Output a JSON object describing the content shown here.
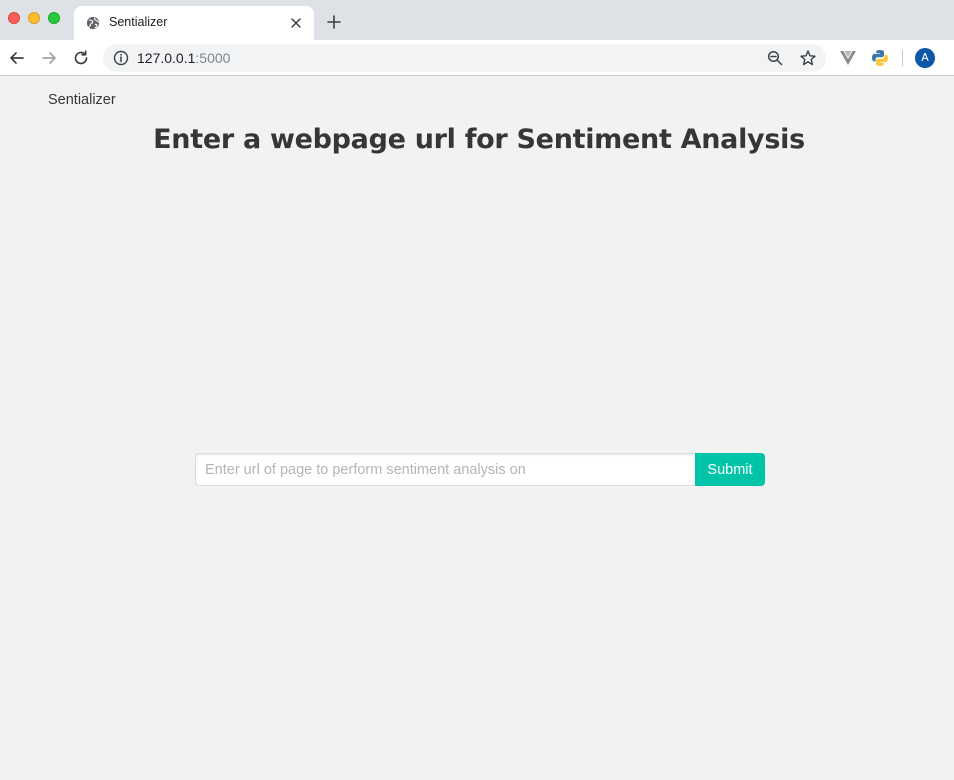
{
  "browser": {
    "tab": {
      "title": "Sentializer",
      "favicon": "globe-icon",
      "close": "close-icon"
    },
    "new_tab": "plus-icon",
    "address": {
      "host": "127.0.0.1",
      "port": ":5000"
    },
    "profile_initial": "A",
    "colors": {
      "tabstrip": "#dee1e6",
      "avatar": "#0b57a8"
    }
  },
  "page": {
    "brand": "Sentializer",
    "title": "Enter a webpage url for Sentiment Analysis",
    "form": {
      "input_value": "",
      "input_placeholder": "Enter url of page to perform sentiment analysis on",
      "submit_label": "Submit"
    },
    "colors": {
      "background": "#f2f2f2",
      "accent": "#00c4a7",
      "text": "#363636"
    }
  }
}
